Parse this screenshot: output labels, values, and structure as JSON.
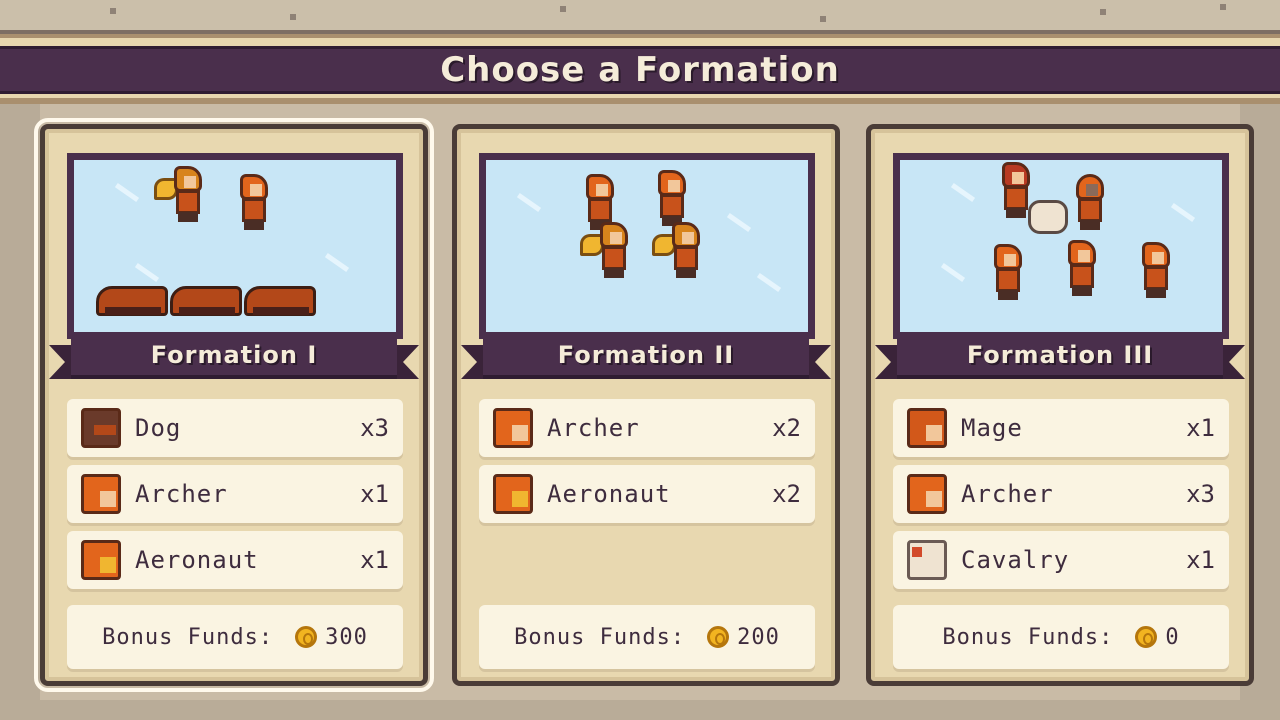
{
  "screen": {
    "title": "Choose a Formation"
  },
  "formations": [
    {
      "name": "Formation I",
      "selected": true,
      "units": [
        {
          "name": "Dog",
          "count": "x3",
          "icon": "dog-portrait-icon"
        },
        {
          "name": "Archer",
          "count": "x1",
          "icon": "archer-portrait-icon"
        },
        {
          "name": "Aeronaut",
          "count": "x1",
          "icon": "aeronaut-portrait-icon"
        }
      ],
      "funds_label": "Bonus Funds:",
      "funds_value": "300"
    },
    {
      "name": "Formation II",
      "selected": false,
      "units": [
        {
          "name": "Archer",
          "count": "x2",
          "icon": "archer-portrait-icon"
        },
        {
          "name": "Aeronaut",
          "count": "x2",
          "icon": "aeronaut-portrait-icon"
        }
      ],
      "funds_label": "Bonus Funds:",
      "funds_value": "200"
    },
    {
      "name": "Formation III",
      "selected": false,
      "units": [
        {
          "name": "Mage",
          "count": "x1",
          "icon": "mage-portrait-icon"
        },
        {
          "name": "Archer",
          "count": "x3",
          "icon": "archer-portrait-icon"
        },
        {
          "name": "Cavalry",
          "count": "x1",
          "icon": "cavalry-portrait-icon"
        }
      ],
      "funds_label": "Bonus Funds:",
      "funds_value": "0"
    }
  ],
  "colors": {
    "banner": "#4a2f4c",
    "card_bg": "#e8d8b0",
    "row_bg": "#faf4e2",
    "text": "#3e2c3e",
    "sky": "#c8e6f6",
    "coin": "#f2b420"
  }
}
